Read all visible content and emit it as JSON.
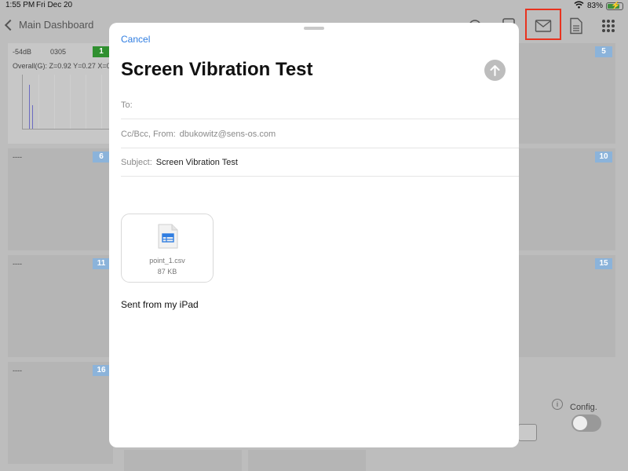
{
  "status_bar": {
    "time": "1:55 PM",
    "date": "Fri Dec 20",
    "battery": "83%"
  },
  "nav": {
    "back_label": "Main Dashboard",
    "icons": [
      "settings-icon",
      "document-icon",
      "mail-icon",
      "report-icon",
      "grid-menu-icon"
    ]
  },
  "dashboard": {
    "tile1": {
      "db": "-54dB",
      "code": "0305",
      "badge": "1",
      "overall": "Overall(G): Z=0.92 Y=0.27 X=0."
    },
    "tiles": [
      {
        "header": "----",
        "badge": "6"
      },
      {
        "header": "----",
        "badge": "11"
      },
      {
        "header": "----",
        "badge": "16"
      },
      {
        "badge": "5"
      },
      {
        "badge": "10"
      },
      {
        "badge": "15"
      }
    ],
    "config_label": "Config.",
    "info_icon_glyph": "i"
  },
  "mail": {
    "cancel_label": "Cancel",
    "subject_title": "Screen Vibration Test",
    "to_label": "To:",
    "to_value": "",
    "ccbcc_label": "Cc/Bcc, From:",
    "from_value": "dbukowitz@sens-os.com",
    "subject_label": "Subject:",
    "subject_value": "Screen Vibration Test",
    "attachment": {
      "name": "point_1.csv",
      "size": "87 KB",
      "icon": "spreadsheet-file-icon"
    },
    "signature": "Sent from my iPad"
  },
  "colors": {
    "accent": "#2f7de1",
    "highlight": "#e8331f",
    "badge_green": "#2f8f2f",
    "badge_blue": "#8bb3da"
  }
}
